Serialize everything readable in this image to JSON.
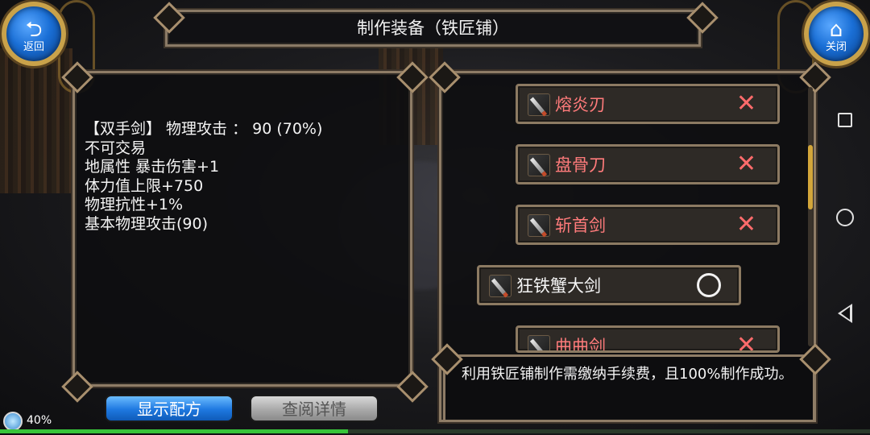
{
  "header": {
    "title": "制作装备（铁匠铺）",
    "back_label": "返回",
    "close_label": "关闭"
  },
  "item_details": {
    "lines": [
      "【双手剑】 物理攻击 ： 90 (70%)",
      "不可交易",
      "地属性 暴击伤害+1",
      "体力值上限+750",
      "物理抗性+1%",
      "基本物理攻击(90)"
    ]
  },
  "recipes": [
    {
      "name": "熔炎刃",
      "mark": "✕",
      "available": false
    },
    {
      "name": "盘骨刀",
      "mark": "✕",
      "available": false
    },
    {
      "name": "斩首剑",
      "mark": "✕",
      "available": false
    },
    {
      "name": "狂铁蟹大剑",
      "mark": "○",
      "available": true
    },
    {
      "name": "曲曲剑",
      "mark": "✕",
      "available": false
    }
  ],
  "info": {
    "text": "利用铁匠铺制作需缴纳手续费，且100%制作成功。"
  },
  "buttons": {
    "show_recipe": "显示配方",
    "view_details": "查阅详情"
  },
  "status": {
    "percent_label": "40%",
    "progress": 0.4
  },
  "colors": {
    "unavailable": "#ff7b7b",
    "available": "#f4f4f4",
    "accent_blue": "#1e78e0",
    "frame": "#8e7c66",
    "progress": "#38c43a"
  },
  "icons": {
    "back": "return-arrow-icon",
    "close": "home-icon",
    "recipe": "sword-icon",
    "nav_recent": "square-icon",
    "nav_home": "circle-icon",
    "nav_back": "triangle-back-icon"
  }
}
